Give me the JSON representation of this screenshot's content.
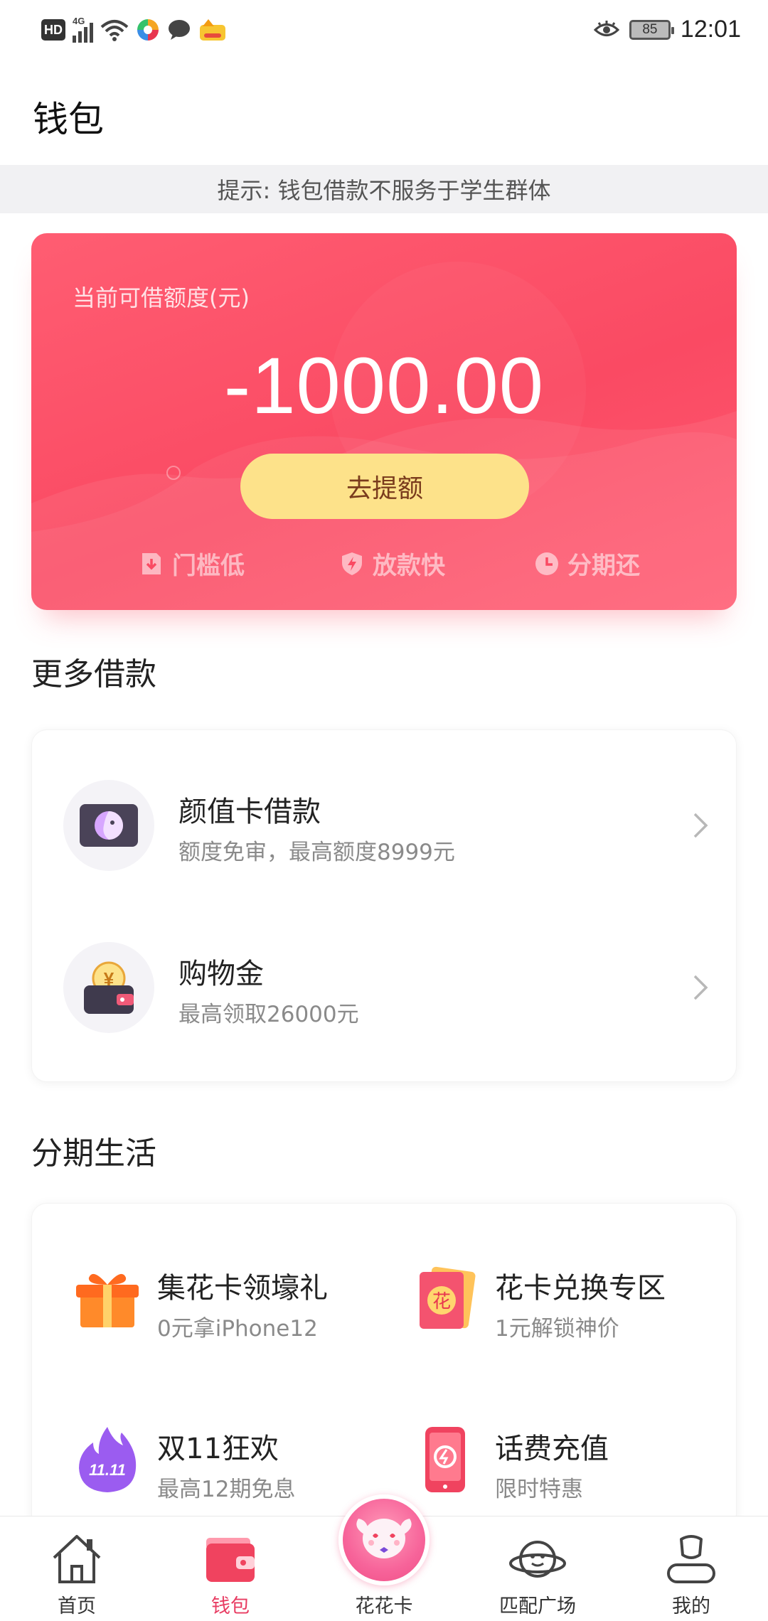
{
  "status_bar": {
    "hd": "HD",
    "network": "4G",
    "battery": "85",
    "time": "12:01"
  },
  "header": {
    "title": "钱包"
  },
  "notice": "提示: 钱包借款不服务于学生群体",
  "credit_card": {
    "label": "当前可借额度(元)",
    "amount": "-1000.00",
    "button": "去提额",
    "features": [
      "门槛低",
      "放款快",
      "分期还"
    ]
  },
  "more_loans": {
    "title": "更多借款",
    "items": [
      {
        "title": "颜值卡借款",
        "subtitle": "额度免审，最高额度8999元",
        "icon": "face-card-icon"
      },
      {
        "title": "购物金",
        "subtitle": "最高领取26000元",
        "icon": "wallet-coin-icon"
      }
    ]
  },
  "installment_life": {
    "title": "分期生活",
    "items": [
      {
        "title": "集花卡领壕礼",
        "subtitle": "0元拿iPhone12",
        "icon": "gift-icon"
      },
      {
        "title": "花卡兑换专区",
        "subtitle": "1元解锁神价",
        "icon": "flower-card-icon",
        "icon_text": "花"
      },
      {
        "title": "双11狂欢",
        "subtitle": "最高12期免息",
        "icon": "fire-1111-icon",
        "icon_text": "11.11"
      },
      {
        "title": "话费充值",
        "subtitle": "限时特惠",
        "icon": "phone-recharge-icon"
      }
    ]
  },
  "bottom_nav": {
    "items": [
      {
        "label": "首页",
        "icon": "home-icon"
      },
      {
        "label": "钱包",
        "icon": "wallet-icon",
        "active": true
      },
      {
        "label": "花花卡",
        "icon": "mascot-icon"
      },
      {
        "label": "匹配广场",
        "icon": "planet-icon"
      },
      {
        "label": "我的",
        "icon": "profile-icon"
      }
    ]
  },
  "colors": {
    "card": "#fa4a63",
    "button": "#fde28a",
    "active_nav": "#e83c62"
  }
}
